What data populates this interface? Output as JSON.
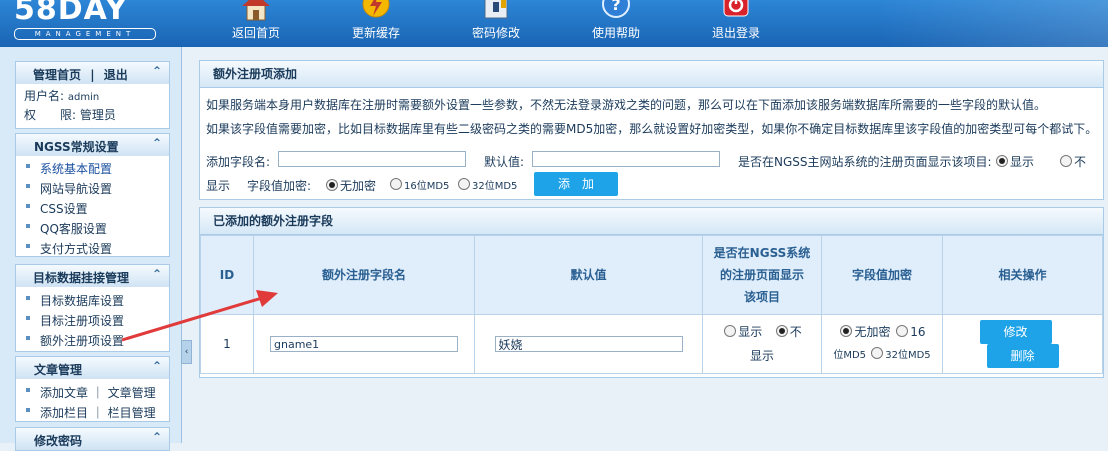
{
  "logo": {
    "title": "58DAY",
    "subtitle": "MANAGEMENT"
  },
  "topnav": [
    {
      "label": "返回首页",
      "icon": "home-icon"
    },
    {
      "label": "更新缓存",
      "icon": "lightning-icon"
    },
    {
      "label": "密码修改",
      "icon": "lock-icon"
    },
    {
      "label": "使用帮助",
      "icon": "help-icon"
    },
    {
      "label": "退出登录",
      "icon": "power-icon"
    }
  ],
  "sidebar": {
    "top": {
      "home": "管理首页",
      "sep": "|",
      "logout": "退出",
      "user_label": "用户名:",
      "user_value": "admin",
      "role_label": "权　　限:",
      "role_value": "管理员"
    },
    "sections": [
      {
        "title": "NGSS常规设置",
        "items": [
          "系统基本配置",
          "网站导航设置",
          "CSS设置",
          "QQ客服设置",
          "支付方式设置"
        ]
      },
      {
        "title": "目标数据挂接管理",
        "items": [
          "目标数据库设置",
          "目标注册项设置",
          "额外注册项设置"
        ]
      },
      {
        "title": "文章管理",
        "items": [
          "添加文章 ｜ 文章管理",
          "添加栏目 ｜ 栏目管理"
        ]
      },
      {
        "title": "修改密码"
      }
    ],
    "collapse_arrow": "‹"
  },
  "add_panel": {
    "title": "额外注册项添加",
    "desc1": "如果服务端本身用户数据库在注册时需要额外设置一些参数，不然无法登录游戏之类的问题，那么可以在下面添加该服务端数据库所需要的一些字段的默认值。",
    "desc2": "如果该字段值需要加密，比如目标数据库里有些二级密码之类的需要MD5加密，那么就设置好加密类型，如果你不确定目标数据库里该字段值的加密类型可每个都试下。",
    "field_label": "添加字段名:",
    "default_label": "默认值:",
    "show_label": "是否在NGSS主网站系统的注册页面显示该项目:",
    "show_yes": "显示",
    "show_no": "不",
    "show_no_2": "显示",
    "encrypt_label": "字段值加密:",
    "enc_none": "无加密",
    "enc_16": "16位MD5",
    "enc_32": "32位MD5",
    "add_button": "添　加"
  },
  "list_panel": {
    "title": "已添加的额外注册字段",
    "columns": {
      "id": "ID",
      "name": "额外注册字段名",
      "default": "默认值",
      "show_1": "是否在NGSS系统",
      "show_2": "的注册页面显示",
      "show_3": "该项目",
      "encrypt": "字段值加密",
      "ops": "相关操作"
    },
    "rows": [
      {
        "id": "1",
        "name": "gname1",
        "default": "妖娆",
        "show_yes": "显示",
        "show_no": "不",
        "show_no_2": "显示",
        "enc_none": "无加密",
        "enc_16a": "16",
        "enc_16b": "位MD5",
        "enc_32": "32位MD5",
        "edit": "修改",
        "delete": "删除"
      }
    ]
  },
  "colors": {
    "accent": "#1ea3e8",
    "topbar": "#1a64b4",
    "annotation": "#e03a3a"
  }
}
